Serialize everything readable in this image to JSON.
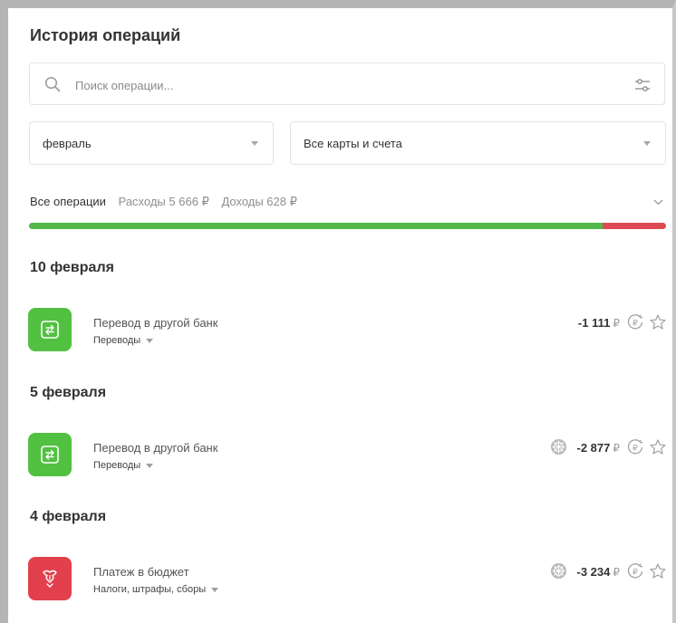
{
  "page": {
    "title": "История операций"
  },
  "search": {
    "placeholder": "Поиск операции..."
  },
  "filters": {
    "month": "февраль",
    "accounts": "Все карты и счета"
  },
  "summary": {
    "all_label": "Все операции",
    "expenses_label": "Расходы 5 666 ₽",
    "income_label": "Доходы 628 ₽",
    "expenses_value": 5666,
    "income_value": 628
  },
  "colors": {
    "expense": "#52b848",
    "income": "#de4a53",
    "transfer_tile": "#52c041",
    "budget_tile": "#e1404c"
  },
  "groups": [
    {
      "date": "10 февраля",
      "operations": [
        {
          "title": "Перевод в другой банк",
          "category": "Переводы",
          "amount": "-1 111",
          "currency": "₽",
          "icon": "transfer-icon",
          "badge": false
        }
      ]
    },
    {
      "date": "5 февраля",
      "operations": [
        {
          "title": "Перевод в другой банк",
          "category": "Переводы",
          "amount": "-2 877",
          "currency": "₽",
          "icon": "transfer-icon",
          "badge": true
        }
      ]
    },
    {
      "date": "4 февраля",
      "operations": [
        {
          "title": "Платеж в бюджет",
          "category": "Налоги, штрафы, сборы",
          "amount": "-3 234",
          "currency": "₽",
          "icon": "budget-emblem-icon",
          "badge": true
        }
      ]
    }
  ]
}
